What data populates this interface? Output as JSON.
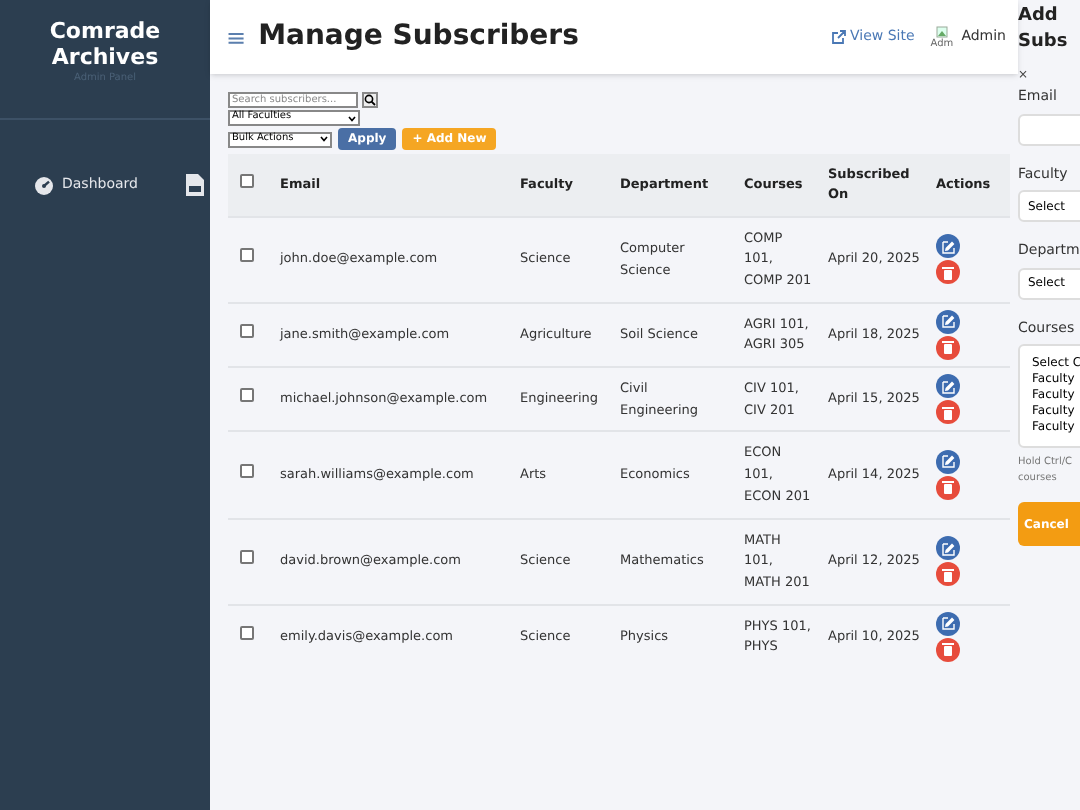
{
  "sidebar": {
    "title": "Comrade Archives",
    "subtitle": "Admin Panel",
    "nav": [
      {
        "label": "Dashboard"
      }
    ]
  },
  "header": {
    "menu_glyph": "≡",
    "title": "Manage Subscribers",
    "view_site": "View Site",
    "avatar_alt": "Adm",
    "user": "Admin"
  },
  "toolbar": {
    "search_placeholder": "Search subscribers...",
    "faculty_filter": "All Faculties",
    "bulk_actions": "Bulk Actions",
    "apply": "Apply",
    "add_new": "+ Add New"
  },
  "table": {
    "header_checked": false,
    "columns": [
      "Email",
      "Faculty",
      "Department",
      "Courses",
      "Subscribed On",
      "Actions"
    ],
    "rows": [
      {
        "checked": false,
        "email": "john.doe@example.com",
        "faculty": "Science",
        "department": "Computer Science",
        "courses": "COMP 101, COMP 201",
        "date": "April 20, 2025"
      },
      {
        "checked": false,
        "email": "jane.smith@example.com",
        "faculty": "Agriculture",
        "department": "Soil Science",
        "courses": "AGRI 101, AGRI 305",
        "date": "April 18, 2025"
      },
      {
        "checked": false,
        "email": "michael.johnson@example.com",
        "faculty": "Engineering",
        "department": "Civil Engineering",
        "courses": "CIV 101, CIV 201",
        "date": "April 15, 2025"
      },
      {
        "checked": false,
        "email": "sarah.williams@example.com",
        "faculty": "Arts",
        "department": "Economics",
        "courses": "ECON 101, ECON 201",
        "date": "April 14, 2025"
      },
      {
        "checked": false,
        "email": "david.brown@example.com",
        "faculty": "Science",
        "department": "Mathematics",
        "courses": "MATH 101, MATH 201",
        "date": "April 12, 2025"
      },
      {
        "checked": false,
        "email": "emily.davis@example.com",
        "faculty": "Science",
        "department": "Physics",
        "courses": "PHYS 101, PHYS",
        "date": "April 10, 2025"
      }
    ]
  },
  "panel": {
    "title_lines": [
      "Add",
      "Subs"
    ],
    "close": "×",
    "email_label": "Email",
    "faculty_label": "Faculty",
    "faculty_select": "Select",
    "department_label": "Departm",
    "department_select": "Select",
    "courses_label": "Courses",
    "course_options": [
      "Select C",
      "Faculty",
      "Faculty",
      "Faculty",
      "Faculty"
    ],
    "hint_lines": [
      "Hold Ctrl/C",
      "courses"
    ],
    "cancel": "Cancel"
  }
}
